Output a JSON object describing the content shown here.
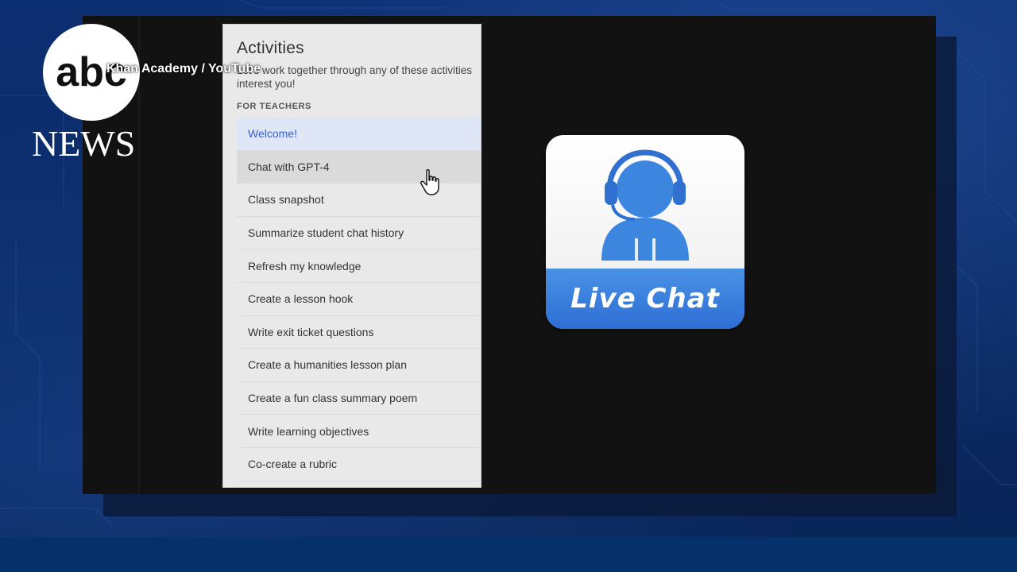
{
  "branding": {
    "logo_text": "abc",
    "news_text": "NEWS",
    "credit": "Khan Academy / YouTube"
  },
  "panel": {
    "title": "Activities",
    "intro": "Let's work together through any of these activities interest you!",
    "section_label": "FOR TEACHERS",
    "items": [
      {
        "label": "Welcome!",
        "state": "selected"
      },
      {
        "label": "Chat with GPT-4",
        "state": "hovered"
      },
      {
        "label": "Class snapshot",
        "state": "normal"
      },
      {
        "label": "Summarize student chat history",
        "state": "normal"
      },
      {
        "label": "Refresh my knowledge",
        "state": "normal"
      },
      {
        "label": "Create a lesson hook",
        "state": "normal"
      },
      {
        "label": "Write exit ticket questions",
        "state": "normal"
      },
      {
        "label": "Create a humanities lesson plan",
        "state": "normal"
      },
      {
        "label": "Create a fun class summary poem",
        "state": "normal"
      },
      {
        "label": "Write learning objectives",
        "state": "normal"
      },
      {
        "label": "Co-create a rubric",
        "state": "normal"
      }
    ]
  },
  "live_chat": {
    "label": "Live Chat",
    "icon": "support-agent-headset-icon"
  },
  "cursor_icon": "hand-pointer-icon",
  "colors": {
    "background": "#0a2a66",
    "selected_item_text": "#3c5fc8",
    "live_chat_blue": "#2d6ed4"
  }
}
